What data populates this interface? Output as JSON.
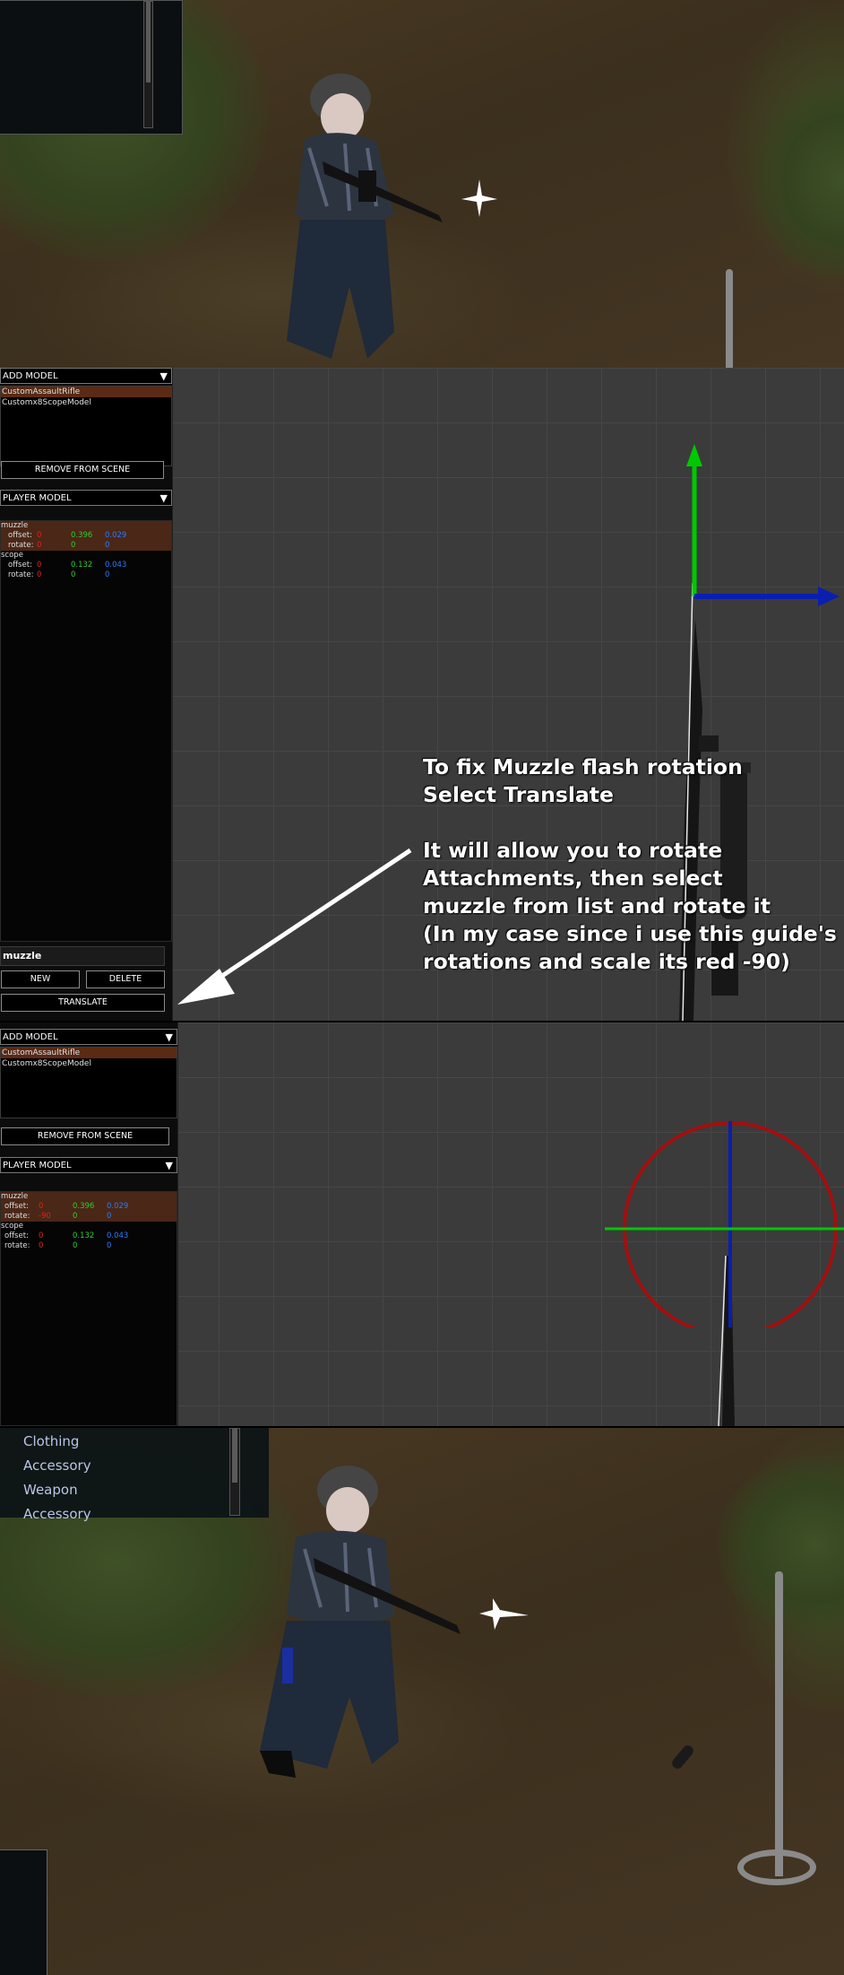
{
  "editor": {
    "add_model_label": "ADD MODEL",
    "models": [
      "CustomAssaultRifle",
      "Customx8ScopeModel"
    ],
    "remove_button": "REMOVE FROM SCENE",
    "player_model_label": "PLAYER MODEL",
    "offset_label": "offset:",
    "rotate_label": "rotate:",
    "attachments_a": [
      {
        "name": "muzzle",
        "offset": [
          "0",
          "0.396",
          "0.029"
        ],
        "rotate": [
          "0",
          "0",
          "0"
        ]
      },
      {
        "name": "scope",
        "offset": [
          "0",
          "0.132",
          "0.043"
        ],
        "rotate": [
          "0",
          "0",
          "0"
        ]
      }
    ],
    "attachments_b": [
      {
        "name": "muzzle",
        "offset": [
          "0",
          "0.396",
          "0.029"
        ],
        "rotate": [
          "-90",
          "0",
          "0"
        ]
      },
      {
        "name": "scope",
        "offset": [
          "0",
          "0.132",
          "0.043"
        ],
        "rotate": [
          "0",
          "0",
          "0"
        ]
      }
    ],
    "attachment_name_value": "muzzle",
    "new_button": "NEW",
    "delete_button": "DELETE",
    "translate_button": "TRANSLATE"
  },
  "annotation": {
    "lines": [
      "To fix Muzzle flash rotation",
      "Select Translate",
      "",
      "It will allow you to rotate",
      "Attachments, then select",
      "muzzle from list and rotate it",
      "(In my case since i use this guide's",
      "rotations and scale its red -90)"
    ]
  },
  "category_list": [
    "Clothing",
    "Accessory",
    "Weapon",
    "Accessory"
  ],
  "colors": {
    "axis_x": "#e02020",
    "axis_y": "#2ecc2e",
    "axis_z": "#2b7bff",
    "gizmo_ring": "#a01010"
  }
}
